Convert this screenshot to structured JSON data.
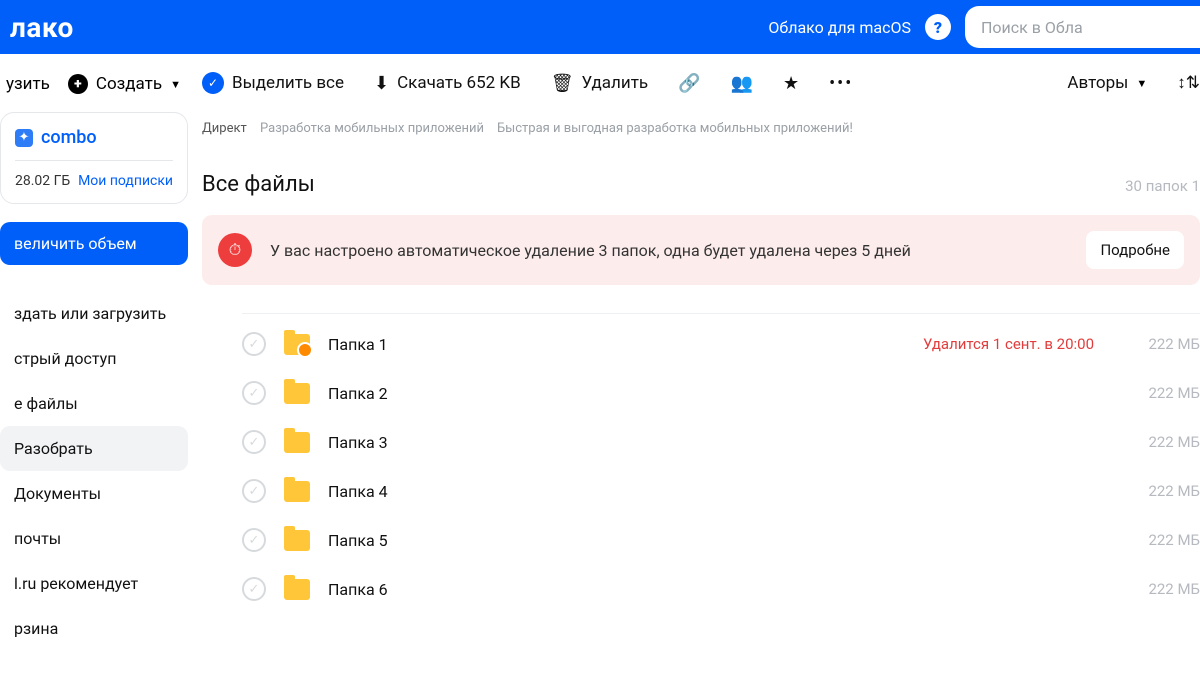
{
  "header": {
    "logo": "лако",
    "macos_label": "Облако для macOS",
    "search_placeholder": "Поиск в Обла"
  },
  "side": {
    "upload_label": "узить",
    "create_label": "Создать",
    "combo_label": "combo",
    "storage_label": "28.02 ГБ",
    "subscriptions_label": "Мои подписки",
    "upgrade_label": "величить объем",
    "nav": [
      "здать или загрузить",
      "стрый доступ",
      "е файлы",
      "Разобрать",
      "Документы",
      "почты",
      "l.ru рекомендует",
      "рзина"
    ],
    "active_index": 3
  },
  "toolbar": {
    "select_all": "Выделить все",
    "download": "Скачать 652 KB",
    "delete": "Удалить",
    "authors": "Авторы"
  },
  "ad": {
    "tag": "Директ",
    "line1": "Разработка мобильных приложений",
    "line2": "Быстрая и выгодная разработка мобильных приложений!"
  },
  "content": {
    "title": "Все файлы",
    "count_label": "30 папок 1"
  },
  "banner": {
    "text": "У вас настроено автоматическое удаление 3 папок, одна будет удалена через 5 дней",
    "button": "Подробне"
  },
  "files": [
    {
      "name": "Папка 1",
      "size": "222 МБ",
      "delete_note": "Удалится 1 сент. в 20:00",
      "timed": true
    },
    {
      "name": "Папка 2",
      "size": "222 МБ",
      "delete_note": "",
      "timed": false
    },
    {
      "name": "Папка 3",
      "size": "222 МБ",
      "delete_note": "",
      "timed": false
    },
    {
      "name": "Папка 4",
      "size": "222 МБ",
      "delete_note": "",
      "timed": false
    },
    {
      "name": "Папка 5",
      "size": "222 МБ",
      "delete_note": "",
      "timed": false
    },
    {
      "name": "Папка 6",
      "size": "222 МБ",
      "delete_note": "",
      "timed": false
    }
  ]
}
